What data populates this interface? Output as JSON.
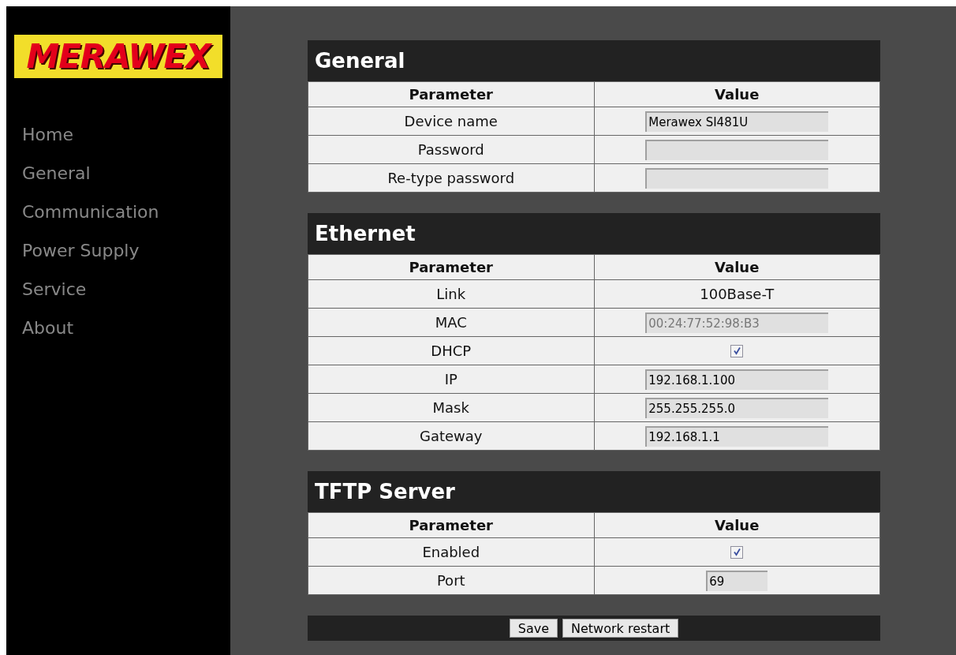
{
  "logo": "MERAWEX",
  "nav": [
    {
      "label": "Home"
    },
    {
      "label": "General"
    },
    {
      "label": "Communication"
    },
    {
      "label": "Power Supply"
    },
    {
      "label": "Service"
    },
    {
      "label": "About"
    }
  ],
  "sections": [
    {
      "title": "General",
      "columns": [
        "Parameter",
        "Value"
      ],
      "rows": [
        {
          "label": "Device name",
          "kind": "input",
          "value": "Merawex SI481U",
          "disabled": false
        },
        {
          "label": "Password",
          "kind": "input"
        },
        {
          "label": "Re-type password",
          "kind": "input"
        }
      ]
    },
    {
      "title": "Ethernet",
      "columns": [
        "Parameter",
        "Value"
      ],
      "rows": [
        {
          "label": "Link",
          "kind": "text",
          "value": "100Base-T"
        },
        {
          "label": "MAC",
          "kind": "input",
          "value": "00:24:77:52:98:B3",
          "disabled": true
        },
        {
          "label": "DHCP",
          "kind": "checkbox",
          "checked": true
        },
        {
          "label": "IP",
          "kind": "input",
          "value": "192.168.1.100",
          "disabled": false
        },
        {
          "label": "Mask",
          "kind": "input",
          "value": "255.255.255.0",
          "disabled": false
        },
        {
          "label": "Gateway",
          "kind": "input",
          "value": "192.168.1.1",
          "disabled": false
        }
      ]
    },
    {
      "title": "TFTP Server",
      "columns": [
        "Parameter",
        "Value"
      ],
      "rows": [
        {
          "label": "Enabled",
          "kind": "checkbox",
          "checked": true
        },
        {
          "label": "Port",
          "kind": "short_input",
          "value": "69",
          "disabled": false
        }
      ]
    }
  ],
  "buttons": [
    "Save",
    "Network restart"
  ]
}
